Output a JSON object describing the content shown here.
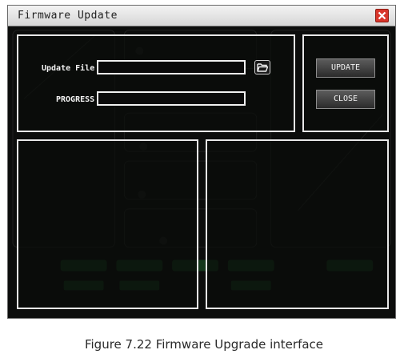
{
  "window": {
    "title": "Firmware Update"
  },
  "form": {
    "update_file_label": "Update File",
    "update_file_value": "",
    "progress_label": "PROGRESS",
    "progress_percent": 0
  },
  "buttons": {
    "update": "UPDATE",
    "close": "CLOSE"
  },
  "caption": "Figure 7.22 Firmware Upgrade interface",
  "colors": {
    "window_bg": "#0c0d0c",
    "panel_border": "#e8e8e8",
    "close_red": "#d8352a",
    "ghost_green": "#1f6b2e"
  },
  "icons": {
    "close": "close-x-icon",
    "browse": "folder-open-icon"
  }
}
